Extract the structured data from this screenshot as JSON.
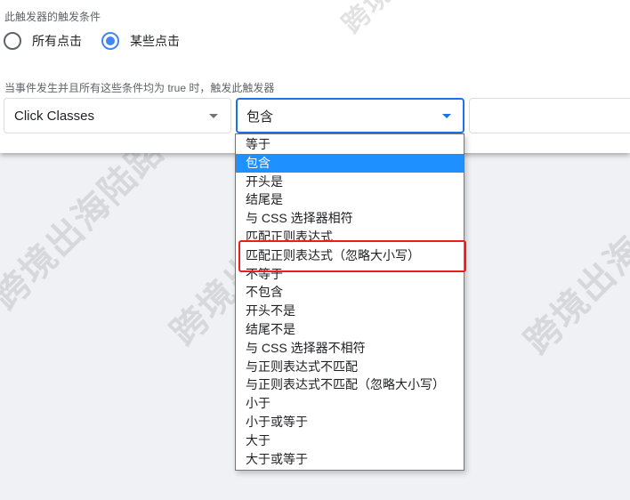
{
  "trigger_conditions": {
    "section_label": "此触发器的触发条件",
    "radio_options": [
      {
        "label": "所有点击",
        "checked": false
      },
      {
        "label": "某些点击",
        "checked": true
      }
    ]
  },
  "condition_row": {
    "label": "当事件发生并且所有这些条件均为 true 时，触发此触发器",
    "variable_select": {
      "value": "Click Classes"
    },
    "operator_select": {
      "value": "包含"
    },
    "value_input": {
      "value": ""
    }
  },
  "operator_dropdown": {
    "selected_index": 1,
    "highlighted_index": 6,
    "options": [
      "等于",
      "包含",
      "开头是",
      "结尾是",
      "与 CSS 选择器相符",
      "匹配正则表达式",
      "匹配正则表达式（忽略大小写）",
      "不等于",
      "不包含",
      "开头不是",
      "结尾不是",
      "与 CSS 选择器不相符",
      "与正则表达式不匹配",
      "与正则表达式不匹配（忽略大小写）",
      "小于",
      "小于或等于",
      "大于",
      "大于或等于"
    ]
  },
  "annotation": {
    "color": "#ee1d1d"
  },
  "colors": {
    "accent": "#1a73e8",
    "radio_checked": "#4285f4",
    "selected_option_bg": "#1e90ff"
  },
  "watermarks": [
    "跨境出海陆路",
    "跨境出海陆路",
    "跨境出海陆路",
    "跨境出海"
  ]
}
